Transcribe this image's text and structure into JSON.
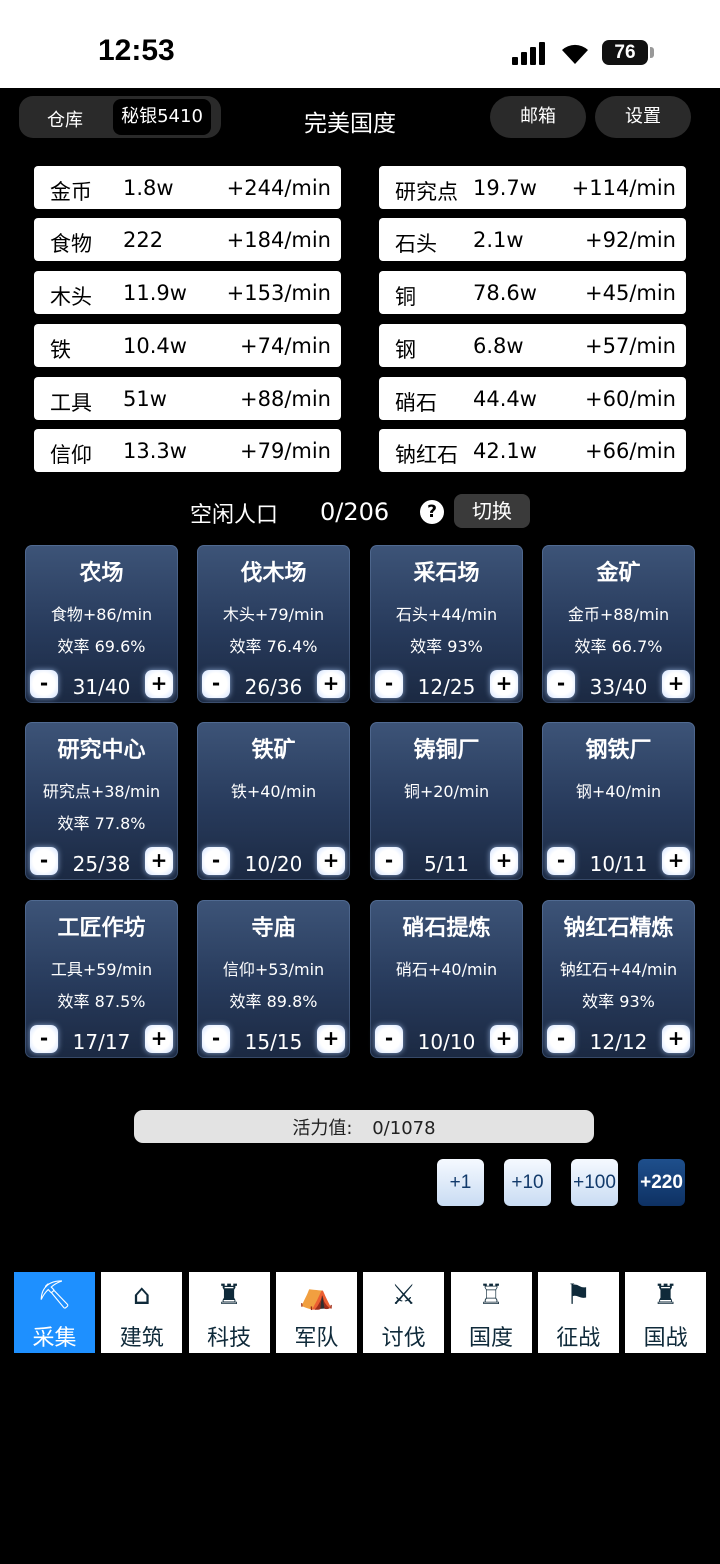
{
  "status": {
    "time": "12:53",
    "battery": "76"
  },
  "header": {
    "warehouse_label": "仓库",
    "warehouse_value": "秘银5410",
    "title": "完美国度",
    "mail_label": "邮箱",
    "settings_label": "设置"
  },
  "resources_left": [
    {
      "name": "金币",
      "value": "1.8w",
      "rate": "+244/min"
    },
    {
      "name": "食物",
      "value": "222",
      "rate": "+184/min"
    },
    {
      "name": "木头",
      "value": "11.9w",
      "rate": "+153/min"
    },
    {
      "name": "铁",
      "value": "10.4w",
      "rate": "+74/min"
    },
    {
      "name": "工具",
      "value": "51w",
      "rate": "+88/min"
    },
    {
      "name": "信仰",
      "value": "13.3w",
      "rate": "+79/min"
    }
  ],
  "resources_right": [
    {
      "name": "研究点",
      "value": "19.7w",
      "rate": "+114/min"
    },
    {
      "name": "石头",
      "value": "2.1w",
      "rate": "+92/min"
    },
    {
      "name": "铜",
      "value": "78.6w",
      "rate": "+45/min"
    },
    {
      "name": "钢",
      "value": "6.8w",
      "rate": "+57/min"
    },
    {
      "name": "硝石",
      "value": "44.4w",
      "rate": "+60/min"
    },
    {
      "name": "钠红石",
      "value": "42.1w",
      "rate": "+66/min"
    }
  ],
  "population": {
    "label": "空闲人口",
    "value": "0/206",
    "help": "?",
    "switch_label": "切换"
  },
  "buildings": [
    {
      "name": "农场",
      "output": "食物+86/min",
      "efficiency": "效率 69.6%",
      "count": "31/40"
    },
    {
      "name": "伐木场",
      "output": "木头+79/min",
      "efficiency": "效率 76.4%",
      "count": "26/36"
    },
    {
      "name": "采石场",
      "output": "石头+44/min",
      "efficiency": "效率 93%",
      "count": "12/25"
    },
    {
      "name": "金矿",
      "output": "金币+88/min",
      "efficiency": "效率 66.7%",
      "count": "33/40"
    },
    {
      "name": "研究中心",
      "output": "研究点+38/min",
      "efficiency": "效率 77.8%",
      "count": "25/38"
    },
    {
      "name": "铁矿",
      "output": "铁+40/min",
      "efficiency": "",
      "count": "10/20"
    },
    {
      "name": "铸铜厂",
      "output": "铜+20/min",
      "efficiency": "",
      "count": "5/11"
    },
    {
      "name": "钢铁厂",
      "output": "钢+40/min",
      "efficiency": "",
      "count": "10/11"
    },
    {
      "name": "工匠作坊",
      "output": "工具+59/min",
      "efficiency": "效率 87.5%",
      "count": "17/17"
    },
    {
      "name": "寺庙",
      "output": "信仰+53/min",
      "efficiency": "效率 89.8%",
      "count": "15/15"
    },
    {
      "name": "硝石提炼",
      "output": "硝石+40/min",
      "efficiency": "",
      "count": "10/10"
    },
    {
      "name": "钠红石精炼",
      "output": "钠红石+44/min",
      "efficiency": "效率 93%",
      "count": "12/12"
    }
  ],
  "controls": {
    "minus": "-",
    "plus": "+"
  },
  "vitality": {
    "label": "活力值:",
    "value": "0/1078"
  },
  "vitality_buttons": [
    "+1",
    "+10",
    "+100",
    "+220"
  ],
  "nav": [
    {
      "label": "采集",
      "icon": "gather-icon",
      "glyph": "⛏"
    },
    {
      "label": "建筑",
      "icon": "building-icon",
      "glyph": "⌂"
    },
    {
      "label": "科技",
      "icon": "tech-icon",
      "glyph": "♜"
    },
    {
      "label": "军队",
      "icon": "army-tent-icon",
      "glyph": "⛺"
    },
    {
      "label": "讨伐",
      "icon": "attack-icon",
      "glyph": "⚔"
    },
    {
      "label": "国度",
      "icon": "castle-icon",
      "glyph": "♖"
    },
    {
      "label": "征战",
      "icon": "campaign-icon",
      "glyph": "⚑"
    },
    {
      "label": "国战",
      "icon": "nation-war-icon",
      "glyph": "♜"
    }
  ]
}
